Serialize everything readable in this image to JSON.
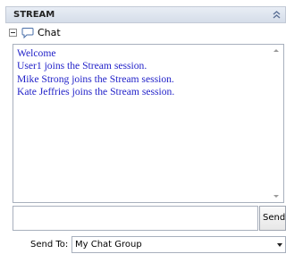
{
  "header": {
    "title": "STREAM",
    "collapse_icon": "double-chevron-up-icon"
  },
  "tree": {
    "node_label": "Chat",
    "node_icon": "chat-bubble-icon"
  },
  "messages": [
    "Welcome",
    "User1 joins the Stream session.",
    "Mike Strong joins the Stream session.",
    "Kate Jeffries joins the Stream session."
  ],
  "composer": {
    "input_value": "",
    "send_label": "Send"
  },
  "send_to": {
    "label": "Send To:",
    "selected": "My Chat Group"
  },
  "colors": {
    "message_text": "#1f1fc8",
    "header_bg": "#dfe5ee",
    "border": "#a8b0bd"
  }
}
